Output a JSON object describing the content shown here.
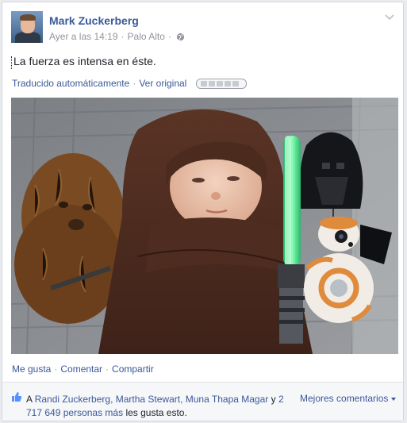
{
  "post": {
    "author": "Mark Zuckerberg",
    "timestamp": "Ayer a las 14:19",
    "location": "Palo Alto",
    "privacy_icon": "globe-icon",
    "text": "La fuerza es intensa en éste.",
    "translation_label": "Traducido automáticamente",
    "see_original": "Ver original",
    "photo_subject": "baby-in-jedi-robe-with-star-wars-toys"
  },
  "actions": {
    "like": "Me gusta",
    "comment": "Comentar",
    "share": "Compartir"
  },
  "likes": {
    "prefix": "A",
    "names": "Randi Zuckerberg, Martha Stewart, Muna Thapa Magar",
    "connector": "y",
    "others": "2 717 649 personas más",
    "suffix": "les gusta esto.",
    "sort_label": "Mejores comentarios"
  },
  "colors": {
    "link": "#3b5998",
    "meta": "#90949c",
    "lightsaber": "#3ee08a"
  }
}
